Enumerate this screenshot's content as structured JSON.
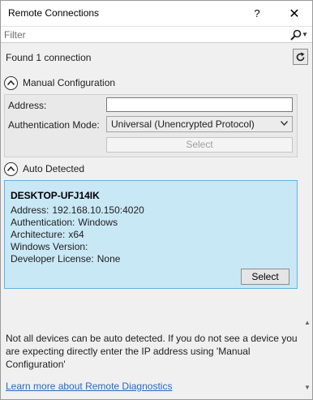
{
  "window": {
    "title": "Remote Connections",
    "help_label": "?",
    "close_label": "✕"
  },
  "filter": {
    "placeholder": "Filter"
  },
  "status": {
    "found_text": "Found 1 connection"
  },
  "manual": {
    "header": "Manual Configuration",
    "address_label": "Address:",
    "address_value": "",
    "auth_label": "Authentication Mode:",
    "auth_value": "Universal (Unencrypted Protocol)",
    "select_label": "Select"
  },
  "auto": {
    "header": "Auto Detected",
    "devices": [
      {
        "name": "DESKTOP-UFJ14IK",
        "address_label": "Address:",
        "address_value": "192.168.10.150:4020",
        "auth_label": "Authentication:",
        "auth_value": "Windows",
        "arch_label": "Architecture:",
        "arch_value": "x64",
        "winver_label": "Windows Version:",
        "winver_value": "",
        "license_label": "Developer License:",
        "license_value": "None",
        "select_label": "Select"
      }
    ]
  },
  "footer": {
    "note": "Not all devices can be auto detected. If you do not see a device you are expecting directly enter the IP address using 'Manual Configuration'",
    "link": "Learn more about Remote Diagnostics"
  },
  "icons": {
    "search": "search-icon",
    "refresh": "refresh-icon",
    "collapse": "chevron-up-circle-icon",
    "dropdown": "chevron-down-icon"
  },
  "colors": {
    "device_card_bg": "#c9e8f6",
    "device_card_border": "#5fb3de",
    "link": "#2a66c8"
  }
}
